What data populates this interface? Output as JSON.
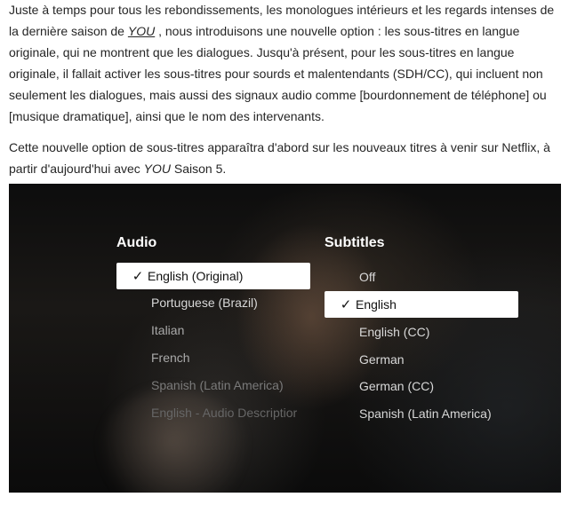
{
  "article": {
    "p1_before_link": "Juste à temps pour tous les rebondissements, les monologues intérieurs et les regards intenses de la dernière saison de ",
    "p1_link": "YOU",
    "p1_after_link": " , nous introduisons une nouvelle option : les sous-titres en langue originale, qui ne montrent que les dialogues. Jusqu'à présent, pour les sous-titres en langue originale, il fallait activer les sous-titres pour sourds et malentendants (SDH/CC), qui incluent non seulement les dialogues, mais aussi des signaux audio comme [bourdonnement de téléphone] ou [musique dramatique], ainsi que le nom des intervenants.",
    "p2_before": "Cette nouvelle option de sous-titres apparaîtra d'abord sur les nouveaux titres à venir sur Netflix, à partir d'aujourd'hui avec ",
    "p2_title": "YOU",
    "p2_after": " Saison 5."
  },
  "player": {
    "audio": {
      "title": "Audio",
      "selected": "English (Original)",
      "options": [
        "English (Original)",
        "Portuguese (Brazil)",
        "Italian",
        "French",
        "Spanish (Latin America)",
        "English - Audio Descriptior"
      ]
    },
    "subtitles": {
      "title": "Subtitles",
      "selected": "English",
      "options": [
        "Off",
        "English",
        "English (CC)",
        "German",
        "German (CC)",
        "Spanish (Latin America)"
      ]
    },
    "check_icon": "checkmark-icon"
  }
}
